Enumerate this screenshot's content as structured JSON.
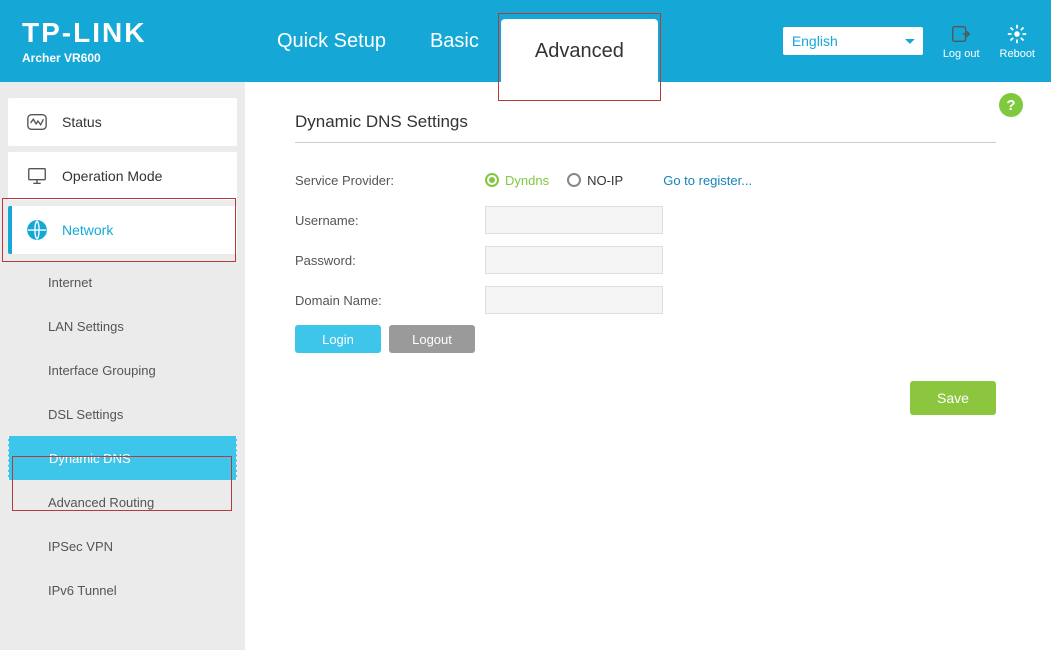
{
  "header": {
    "brand": "TP-LINK",
    "model": "Archer VR600",
    "nav": {
      "quick": "Quick Setup",
      "basic": "Basic",
      "advanced": "Advanced"
    },
    "language": "English",
    "logout": "Log out",
    "reboot": "Reboot"
  },
  "sidebar": {
    "status": "Status",
    "operation_mode": "Operation Mode",
    "network": "Network",
    "sub": {
      "internet": "Internet",
      "lan": "LAN Settings",
      "ifgroup": "Interface Grouping",
      "dsl": "DSL Settings",
      "ddns": "Dynamic DNS",
      "advrouting": "Advanced Routing",
      "ipsec": "IPSec VPN",
      "ipv6": "IPv6 Tunnel"
    }
  },
  "panel": {
    "title": "Dynamic DNS Settings",
    "help": "?",
    "labels": {
      "service_provider": "Service Provider:",
      "username": "Username:",
      "password": "Password:",
      "domain": "Domain Name:"
    },
    "radios": {
      "dyndns": "Dyndns",
      "noip": "NO-IP"
    },
    "register_link": "Go to register...",
    "values": {
      "username": "",
      "password": "",
      "domain": ""
    },
    "buttons": {
      "login": "Login",
      "logout": "Logout",
      "save": "Save"
    }
  }
}
